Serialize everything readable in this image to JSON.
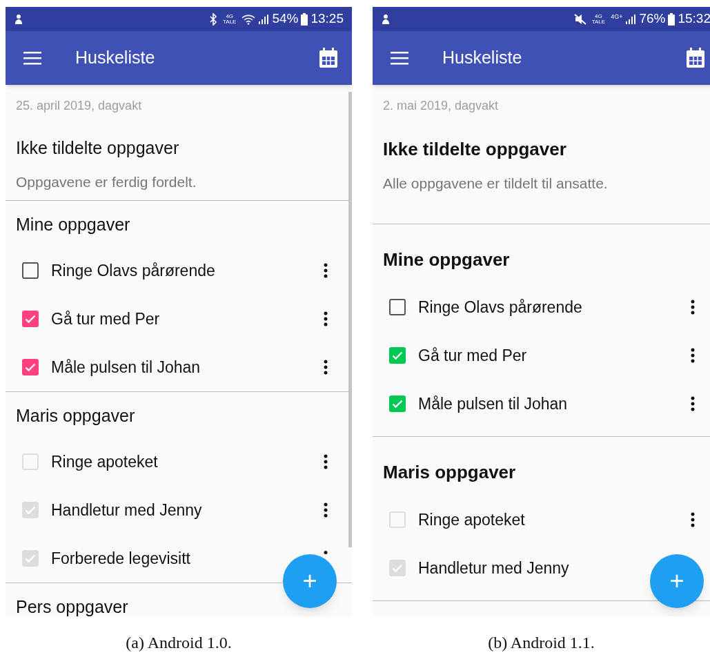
{
  "phones": [
    {
      "kind": "v1_0",
      "status": {
        "network": [
          "4G",
          "TALE"
        ],
        "battery": "54%",
        "time": "13:25"
      },
      "title": "Huskeliste",
      "date": "25. april 2019, dagvakt",
      "unassigned": {
        "heading": "Ikke tildelte oppgaver",
        "note": "Oppgavene er ferdig fordelt."
      },
      "sections": [
        {
          "heading": "Mine oppgaver",
          "tasks": [
            {
              "label": "Ringe Olavs pårørende",
              "checked": false,
              "disabled": false,
              "menu_covered": false
            },
            {
              "label": "Gå tur med Per",
              "checked": true,
              "disabled": false,
              "menu_covered": false
            },
            {
              "label": "Måle pulsen til Johan",
              "checked": true,
              "disabled": false,
              "menu_covered": false
            }
          ]
        },
        {
          "heading": "Maris oppgaver",
          "tasks": [
            {
              "label": "Ringe apoteket",
              "checked": false,
              "disabled": true,
              "menu_covered": false
            },
            {
              "label": "Handletur med Jenny",
              "checked": true,
              "disabled": true,
              "menu_covered": false
            },
            {
              "label": "Forberede legevisitt",
              "checked": true,
              "disabled": true,
              "menu_covered": true
            }
          ]
        },
        {
          "heading": "Pers oppgaver"
        }
      ],
      "fab": "+",
      "caption": "(a) Android 1.0."
    },
    {
      "kind": "v1_1",
      "status": {
        "network": [
          "4G",
          "TALE"
        ],
        "extra": "4G+",
        "battery": "76%",
        "time": "15:32"
      },
      "title": "Huskeliste",
      "date": "2. mai 2019, dagvakt",
      "unassigned": {
        "heading": "Ikke tildelte oppgaver",
        "note": "Alle oppgavene er tildelt til ansatte."
      },
      "sections": [
        {
          "heading": "Mine oppgaver",
          "tasks": [
            {
              "label": "Ringe Olavs pårørende",
              "checked": false,
              "disabled": false,
              "menu_covered": false
            },
            {
              "label": "Gå tur med Per",
              "checked": true,
              "disabled": false,
              "menu_covered": false
            },
            {
              "label": "Måle pulsen til Johan",
              "checked": true,
              "disabled": false,
              "menu_covered": false
            }
          ]
        },
        {
          "heading": "Maris oppgaver",
          "tasks": [
            {
              "label": "Ringe apoteket",
              "checked": false,
              "disabled": true,
              "menu_covered": false
            },
            {
              "label": "Handletur med Jenny",
              "checked": true,
              "disabled": true
            }
          ]
        }
      ],
      "fab": "+",
      "caption": "(b) Android 1.1."
    }
  ]
}
